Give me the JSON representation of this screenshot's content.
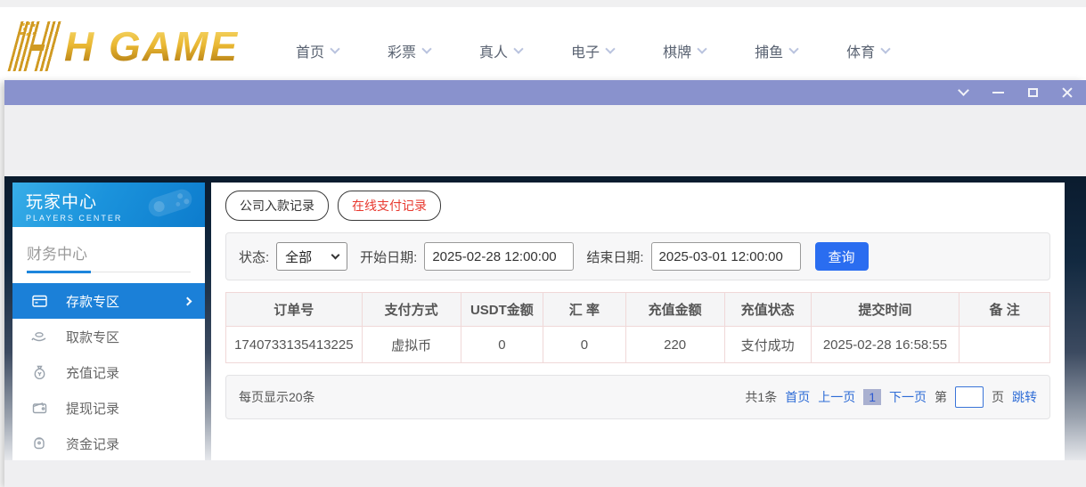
{
  "header": {
    "logo_text": "H GAME",
    "nav": [
      {
        "label": "首页"
      },
      {
        "label": "彩票"
      },
      {
        "label": "真人"
      },
      {
        "label": "电子"
      },
      {
        "label": "棋牌"
      },
      {
        "label": "捕鱼"
      },
      {
        "label": "体育"
      }
    ]
  },
  "titlebar": {
    "controls": [
      "chevron-down",
      "minimize",
      "maximize",
      "close"
    ]
  },
  "sidebar": {
    "title": "玩家中心",
    "subtitle": "PLAYERS CENTER",
    "section": "财务中心",
    "items": [
      {
        "label": "存款专区",
        "icon": "bank-card-icon",
        "active": true
      },
      {
        "label": "取款专区",
        "icon": "hand-coin-icon",
        "active": false
      },
      {
        "label": "充值记录",
        "icon": "money-bag-icon",
        "active": false
      },
      {
        "label": "提现记录",
        "icon": "wallet-icon",
        "active": false
      },
      {
        "label": "资金记录",
        "icon": "coin-purse-icon",
        "active": false
      }
    ]
  },
  "main": {
    "tabs": [
      {
        "label": "公司入款记录",
        "active": false
      },
      {
        "label": "在线支付记录",
        "active": true
      }
    ],
    "filters": {
      "status_label": "状态:",
      "status_value": "全部",
      "start_label": "开始日期:",
      "start_value": "2025-02-28 12:00:00",
      "end_label": "结束日期:",
      "end_value": "2025-03-01 12:00:00",
      "query_button": "查询"
    },
    "table": {
      "headers": [
        "订单号",
        "支付方式",
        "USDT金额",
        "汇 率",
        "充值金额",
        "充值状态",
        "提交时间",
        "备 注"
      ],
      "rows": [
        [
          "1740733135413225",
          "虚拟币",
          "0",
          "0",
          "220",
          "支付成功",
          "2025-02-28 16:58:55",
          ""
        ]
      ]
    },
    "pagination": {
      "per_page": "每页显示20条",
      "total": "共1条",
      "first": "首页",
      "prev": "上一页",
      "current": "1",
      "next": "下一页",
      "jump_prefix": "第",
      "jump_suffix": "页",
      "jump_button": "跳转"
    }
  },
  "colors": {
    "titlebar": "#8992cd",
    "sidebar_header_blue": "#1b93dc",
    "active_menu_blue": "#1b80d8",
    "query_button_blue": "#2a6df0",
    "link_blue": "#2e6cd6",
    "active_tab_red": "#e8392f",
    "logo_gold": "#e9b732",
    "table_border_pink": "#f0d8d8"
  }
}
